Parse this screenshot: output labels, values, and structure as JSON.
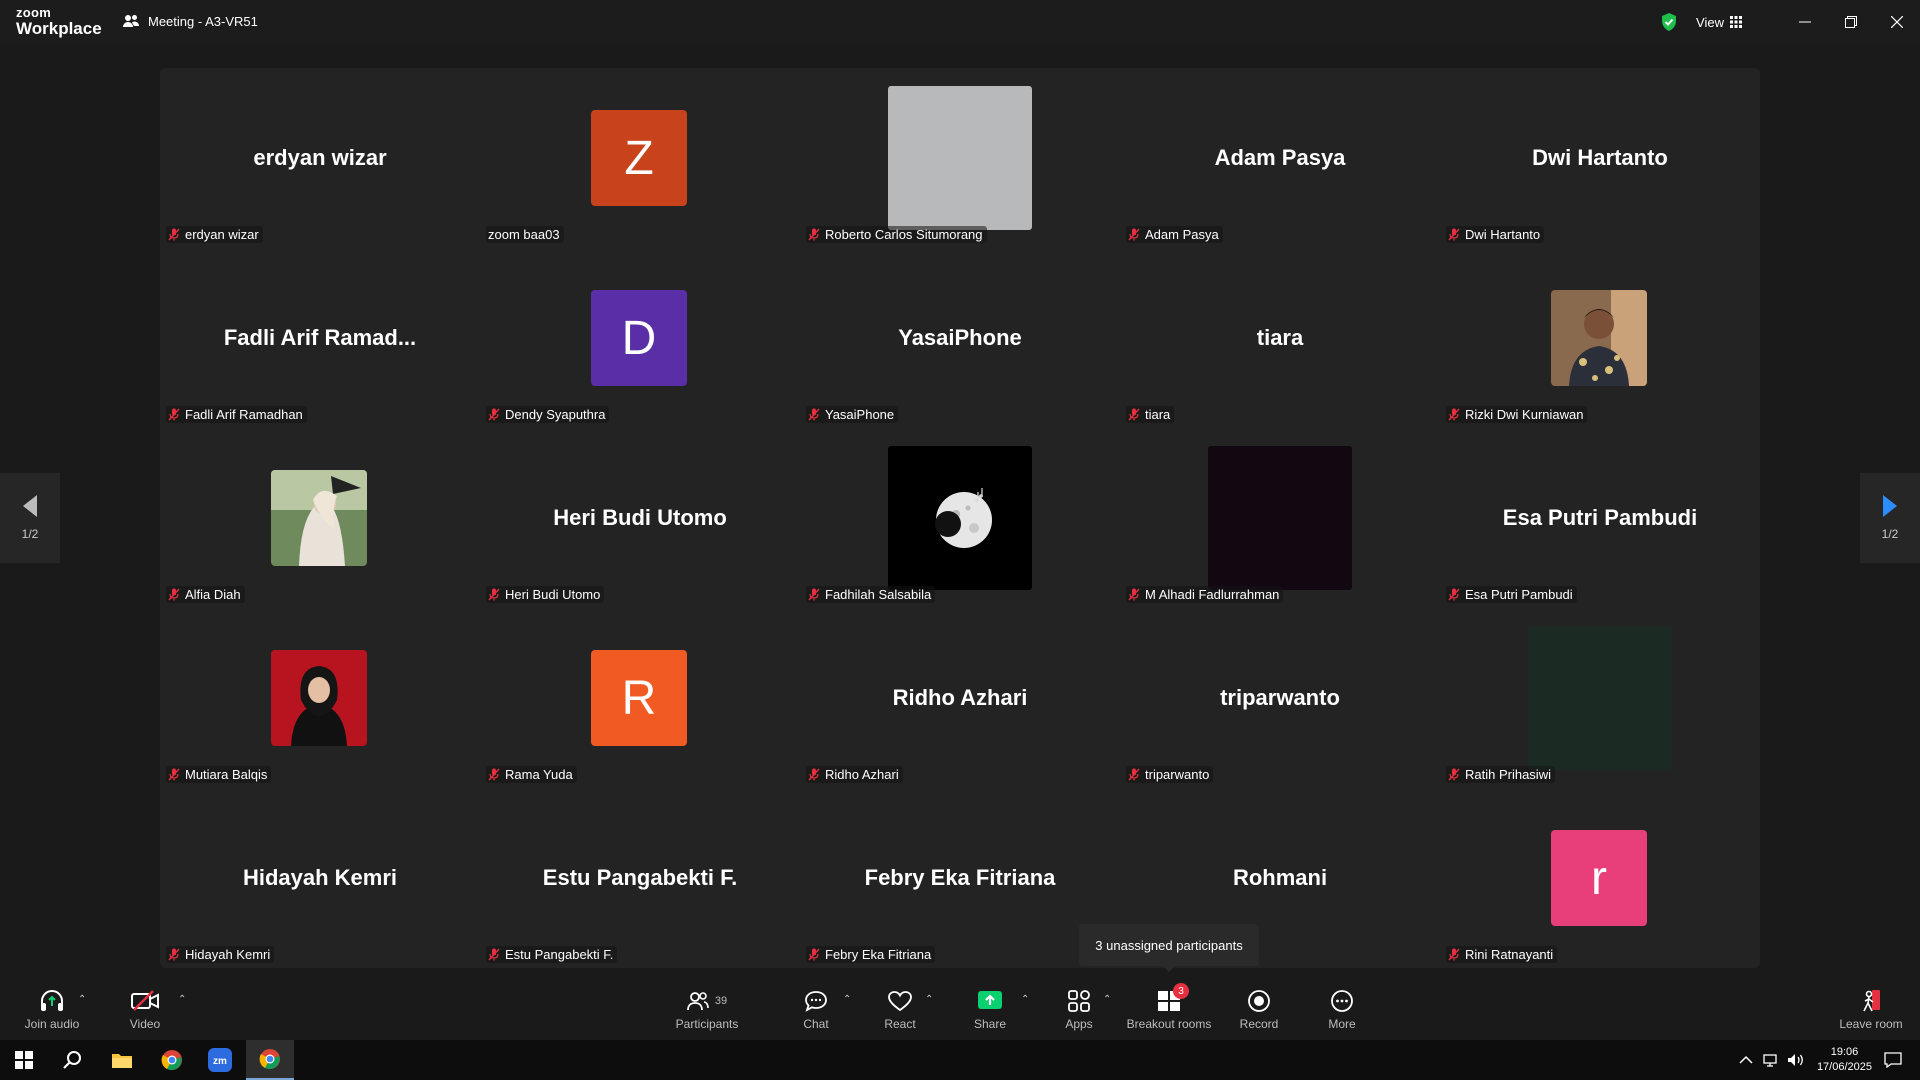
{
  "app": {
    "brand_line1": "zoom",
    "brand_line2": "Workplace",
    "meeting_title": "Meeting - A3-VR51",
    "view_label": "View"
  },
  "pagination": {
    "left": "1/2",
    "right": "1/2"
  },
  "tooltip": "3 unassigned participants",
  "tiles": [
    {
      "display": "name",
      "big": "erdyan wizar",
      "label": "erdyan wizar",
      "muted": true
    },
    {
      "display": "letter",
      "letter": "Z",
      "color": "#c8421b",
      "label": "zoom baa03",
      "muted": false
    },
    {
      "display": "video",
      "color": "#b8b9bb",
      "label": "Roberto Carlos Situmorang",
      "muted": true
    },
    {
      "display": "name",
      "big": "Adam Pasya",
      "label": "Adam Pasya",
      "muted": true
    },
    {
      "display": "name",
      "big": "Dwi Hartanto",
      "label": "Dwi Hartanto",
      "muted": true
    },
    {
      "display": "name",
      "big": "Fadli Arif Ramad...",
      "label": "Fadli Arif Ramadhan",
      "muted": true
    },
    {
      "display": "letter",
      "letter": "D",
      "color": "#5a2ea6",
      "label": "Dendy Syaputhra",
      "muted": true
    },
    {
      "display": "name",
      "big": "YasaiPhone",
      "label": "YasaiPhone",
      "muted": true
    },
    {
      "display": "name",
      "big": "tiara",
      "label": "tiara",
      "muted": true
    },
    {
      "display": "photo",
      "photo": "man",
      "label": "Rizki Dwi Kurniawan",
      "muted": true
    },
    {
      "display": "photo",
      "photo": "woman-outdoor",
      "label": "Alfia Diah",
      "muted": true
    },
    {
      "display": "name",
      "big": "Heri Budi Utomo",
      "label": "Heri Budi Utomo",
      "muted": true
    },
    {
      "display": "video-moon",
      "color": "#000000",
      "label": "Fadhilah Salsabila",
      "muted": true
    },
    {
      "display": "video",
      "color": "#120812",
      "label": "M Alhadi Fadlurrahman",
      "muted": true
    },
    {
      "display": "name",
      "big": "Esa Putri Pambudi",
      "label": "Esa Putri Pambudi",
      "muted": true
    },
    {
      "display": "photo",
      "photo": "hijab",
      "label": "Mutiara Balqis",
      "muted": true
    },
    {
      "display": "letter",
      "letter": "R",
      "color": "#f15a22",
      "label": "Rama Yuda",
      "muted": true
    },
    {
      "display": "name",
      "big": "Ridho Azhari",
      "label": "Ridho Azhari",
      "muted": true
    },
    {
      "display": "name",
      "big": "triparwanto",
      "label": "triparwanto",
      "muted": true
    },
    {
      "display": "video",
      "color": "#1c2a24",
      "label": "Ratih Prihasiwi",
      "muted": true
    },
    {
      "display": "name",
      "big": "Hidayah Kemri",
      "label": "Hidayah Kemri",
      "muted": true
    },
    {
      "display": "name",
      "big": "Estu Pangabekti F.",
      "label": "Estu Pangabekti F.",
      "muted": true
    },
    {
      "display": "name",
      "big": "Febry Eka Fitriana",
      "label": "Febry Eka Fitriana",
      "muted": true
    },
    {
      "display": "name",
      "big": "Rohmani",
      "label": "",
      "muted": false
    },
    {
      "display": "letter",
      "letter": "r",
      "color": "#e83e7a",
      "label": "Rini Ratnayanti",
      "muted": true
    }
  ],
  "toolbar": {
    "join_audio": "Join audio",
    "video": "Video",
    "participants": "Participants",
    "participants_count": "39",
    "chat": "Chat",
    "react": "React",
    "share": "Share",
    "apps": "Apps",
    "breakout": "Breakout rooms",
    "breakout_badge": "3",
    "record": "Record",
    "more": "More",
    "leave": "Leave room"
  },
  "taskbar": {
    "time": "19:06",
    "date": "17/06/2025"
  },
  "colors": {
    "share_green": "#0bd070",
    "video_off_red": "#e5303f",
    "mic_off_red": "#e5303f"
  }
}
